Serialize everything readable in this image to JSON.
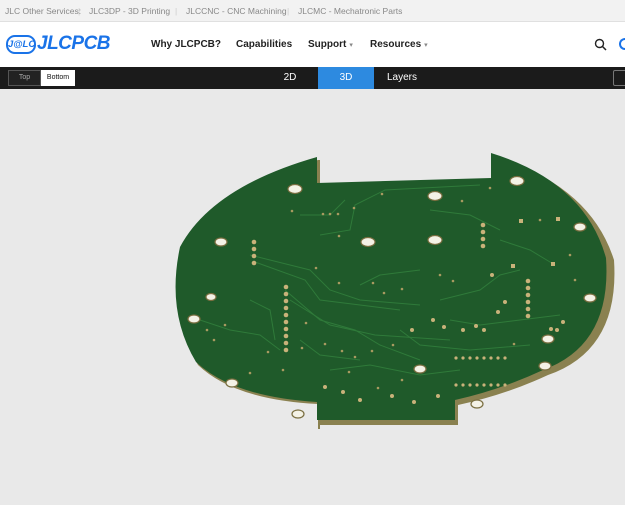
{
  "topbar": {
    "label": "JLC Other Services:",
    "links": [
      "JLC3DP - 3D Printing",
      "JLCCNC - CNC Machining",
      "JLCMC - Mechatronic Parts"
    ]
  },
  "header": {
    "logo_badge": "J@LC",
    "logo_text": "JLCPCB",
    "nav": [
      "Why JLCPCB?",
      "Capabilities",
      "Support",
      "Resources"
    ],
    "dropdown_glyph": "▾"
  },
  "toolbar": {
    "side_options": [
      "Top",
      "Bottom"
    ],
    "selected_side": "Bottom",
    "view_tabs": [
      "2D",
      "3D",
      "Layers"
    ],
    "active_view": "3D"
  },
  "icons": [
    "search-icon",
    "chevron-down-icon"
  ],
  "colors": {
    "brand": "#1a73e8",
    "board": "#1f5a2a",
    "board_edge": "#8a8150",
    "pads": "#c9b27a",
    "active_tab": "#2d8ae0"
  }
}
